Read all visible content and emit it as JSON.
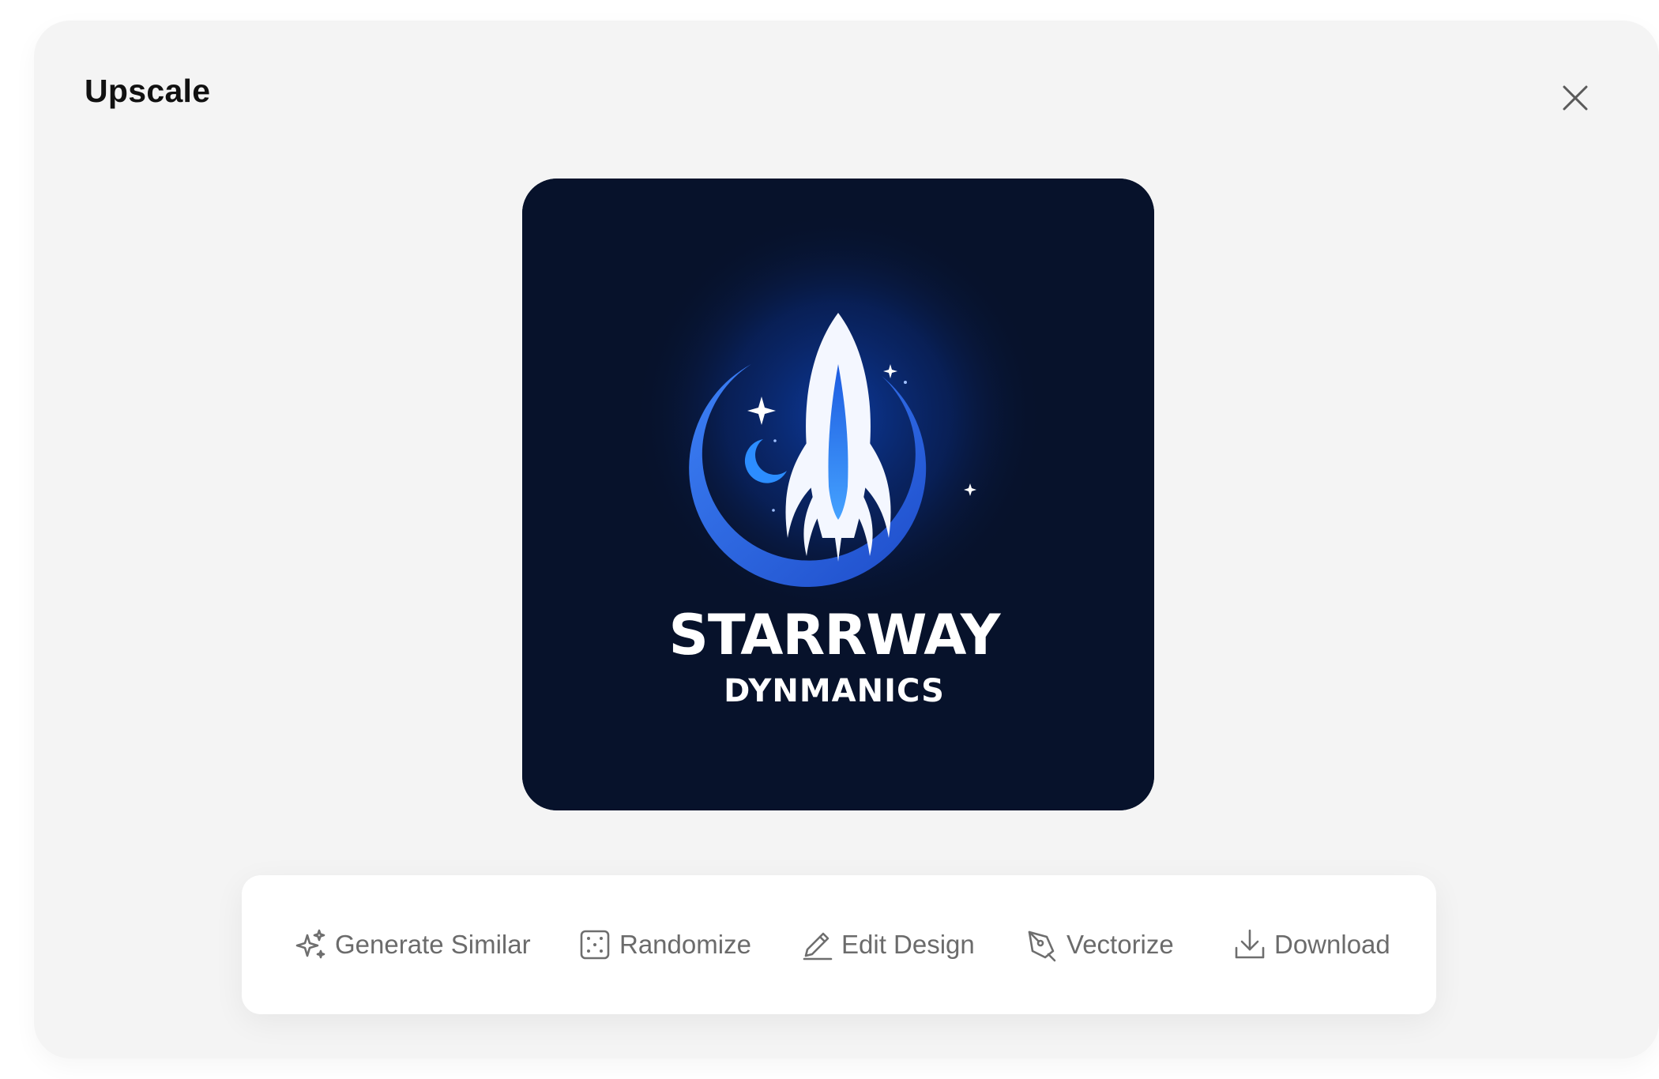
{
  "modal": {
    "title": "Upscale"
  },
  "image": {
    "brand_line1": "STARRWAY",
    "brand_line2": "DYNMANICS",
    "background_color": "#07122b",
    "accent_color": "#2f6df0"
  },
  "toolbar": {
    "actions": [
      {
        "label": "Generate Similar",
        "icon": "sparkles-icon"
      },
      {
        "label": "Randomize",
        "icon": "dice-icon"
      },
      {
        "label": "Edit Design",
        "icon": "pencil-icon"
      },
      {
        "label": "Vectorize",
        "icon": "pen-nib-icon"
      },
      {
        "label": "Download",
        "icon": "download-icon"
      }
    ]
  },
  "colors": {
    "modal_bg": "#f4f4f4",
    "toolbar_bg": "#ffffff",
    "icon_gray": "#6e6e6e"
  }
}
